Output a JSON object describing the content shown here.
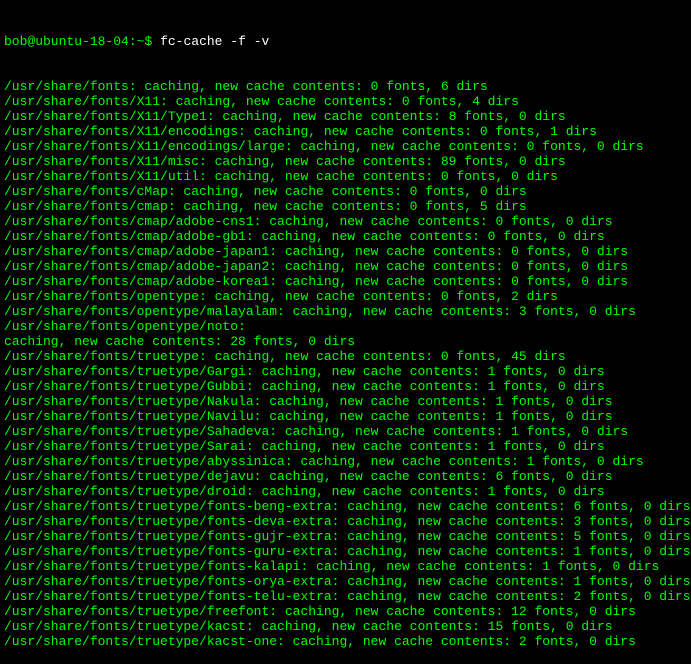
{
  "prompt": {
    "user_host": "bob@ubuntu-18-04",
    "separator": ":",
    "path": "~",
    "symbol": "$"
  },
  "command": "fc-cache -f -v",
  "output_lines": [
    "/usr/share/fonts: caching, new cache contents: 0 fonts, 6 dirs",
    "/usr/share/fonts/X11: caching, new cache contents: 0 fonts, 4 dirs",
    "/usr/share/fonts/X11/Type1: caching, new cache contents: 8 fonts, 0 dirs",
    "/usr/share/fonts/X11/encodings: caching, new cache contents: 0 fonts, 1 dirs",
    "/usr/share/fonts/X11/encodings/large: caching, new cache contents: 0 fonts, 0 dirs",
    "/usr/share/fonts/X11/misc: caching, new cache contents: 89 fonts, 0 dirs",
    "/usr/share/fonts/X11/util: caching, new cache contents: 0 fonts, 0 dirs",
    "/usr/share/fonts/cMap: caching, new cache contents: 0 fonts, 0 dirs",
    "/usr/share/fonts/cmap: caching, new cache contents: 0 fonts, 5 dirs",
    "/usr/share/fonts/cmap/adobe-cns1: caching, new cache contents: 0 fonts, 0 dirs",
    "/usr/share/fonts/cmap/adobe-gb1: caching, new cache contents: 0 fonts, 0 dirs",
    "/usr/share/fonts/cmap/adobe-japan1: caching, new cache contents: 0 fonts, 0 dirs",
    "/usr/share/fonts/cmap/adobe-japan2: caching, new cache contents: 0 fonts, 0 dirs",
    "/usr/share/fonts/cmap/adobe-korea1: caching, new cache contents: 0 fonts, 0 dirs",
    "/usr/share/fonts/opentype: caching, new cache contents: 0 fonts, 2 dirs",
    "/usr/share/fonts/opentype/malayalam: caching, new cache contents: 3 fonts, 0 dirs",
    "/usr/share/fonts/opentype/noto:",
    "caching, new cache contents: 28 fonts, 0 dirs",
    "/usr/share/fonts/truetype: caching, new cache contents: 0 fonts, 45 dirs",
    "/usr/share/fonts/truetype/Gargi: caching, new cache contents: 1 fonts, 0 dirs",
    "/usr/share/fonts/truetype/Gubbi: caching, new cache contents: 1 fonts, 0 dirs",
    "/usr/share/fonts/truetype/Nakula: caching, new cache contents: 1 fonts, 0 dirs",
    "/usr/share/fonts/truetype/Navilu: caching, new cache contents: 1 fonts, 0 dirs",
    "/usr/share/fonts/truetype/Sahadeva: caching, new cache contents: 1 fonts, 0 dirs",
    "/usr/share/fonts/truetype/Sarai: caching, new cache contents: 1 fonts, 0 dirs",
    "/usr/share/fonts/truetype/abyssinica: caching, new cache contents: 1 fonts, 0 dirs",
    "/usr/share/fonts/truetype/dejavu: caching, new cache contents: 6 fonts, 0 dirs",
    "/usr/share/fonts/truetype/droid: caching, new cache contents: 1 fonts, 0 dirs",
    "/usr/share/fonts/truetype/fonts-beng-extra: caching, new cache contents: 6 fonts, 0 dirs",
    "/usr/share/fonts/truetype/fonts-deva-extra: caching, new cache contents: 3 fonts, 0 dirs",
    "/usr/share/fonts/truetype/fonts-gujr-extra: caching, new cache contents: 5 fonts, 0 dirs",
    "/usr/share/fonts/truetype/fonts-guru-extra: caching, new cache contents: 1 fonts, 0 dirs",
    "/usr/share/fonts/truetype/fonts-kalapi: caching, new cache contents: 1 fonts, 0 dirs",
    "/usr/share/fonts/truetype/fonts-orya-extra: caching, new cache contents: 1 fonts, 0 dirs",
    "/usr/share/fonts/truetype/fonts-telu-extra: caching, new cache contents: 2 fonts, 0 dirs",
    "/usr/share/fonts/truetype/freefont: caching, new cache contents: 12 fonts, 0 dirs",
    "/usr/share/fonts/truetype/kacst: caching, new cache contents: 15 fonts, 0 dirs",
    "/usr/share/fonts/truetype/kacst-one: caching, new cache contents: 2 fonts, 0 dirs"
  ]
}
